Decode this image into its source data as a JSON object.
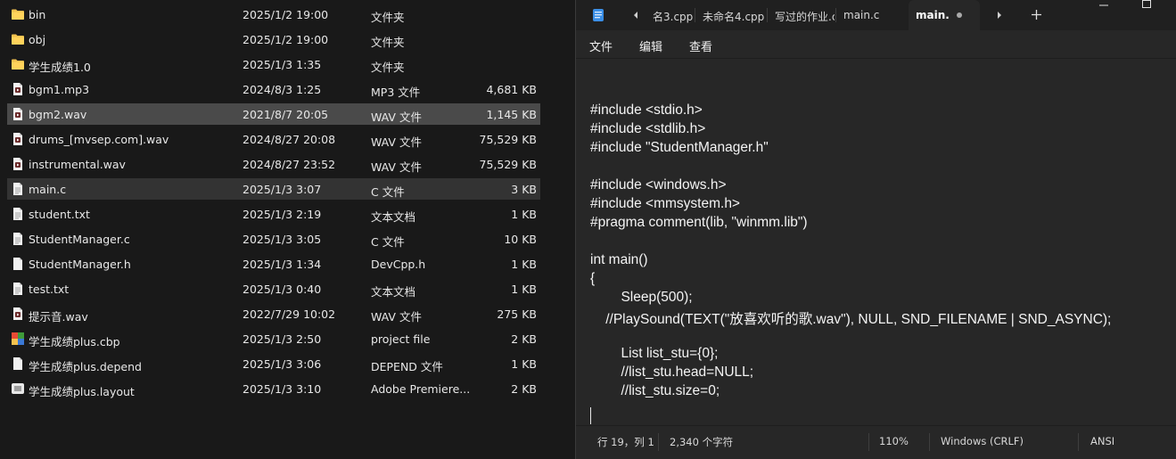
{
  "explorer": {
    "files": [
      {
        "name": "bin",
        "date": "2025/1/2 19:00",
        "type": "文件夹",
        "size": "",
        "icon": "folder-icon"
      },
      {
        "name": "obj",
        "date": "2025/1/2 19:00",
        "type": "文件夹",
        "size": "",
        "icon": "folder-icon"
      },
      {
        "name": "学生成绩1.0",
        "date": "2025/1/3 1:35",
        "type": "文件夹",
        "size": "",
        "icon": "folder-icon"
      },
      {
        "name": "bgm1.mp3",
        "date": "2024/8/3 1:25",
        "type": "MP3 文件",
        "size": "4,681 KB",
        "icon": "media-file-icon"
      },
      {
        "name": "bgm2.wav",
        "date": "2021/8/7 20:05",
        "type": "WAV 文件",
        "size": "1,145 KB",
        "icon": "media-file-icon"
      },
      {
        "name": "drums_[mvsep.com].wav",
        "date": "2024/8/27 20:08",
        "type": "WAV 文件",
        "size": "75,529 KB",
        "icon": "media-file-icon"
      },
      {
        "name": "instrumental.wav",
        "date": "2024/8/27 23:52",
        "type": "WAV 文件",
        "size": "75,529 KB",
        "icon": "media-file-icon"
      },
      {
        "name": "main.c",
        "date": "2025/1/3 3:07",
        "type": "C 文件",
        "size": "3 KB",
        "icon": "text-file-icon"
      },
      {
        "name": "student.txt",
        "date": "2025/1/3 2:19",
        "type": "文本文档",
        "size": "1 KB",
        "icon": "text-file-icon"
      },
      {
        "name": "StudentManager.c",
        "date": "2025/1/3 3:05",
        "type": "C 文件",
        "size": "10 KB",
        "icon": "text-file-icon"
      },
      {
        "name": "StudentManager.h",
        "date": "2025/1/3 1:34",
        "type": "DevCpp.h",
        "size": "1 KB",
        "icon": "blank-file-icon"
      },
      {
        "name": "test.txt",
        "date": "2025/1/3 0:40",
        "type": "文本文档",
        "size": "1 KB",
        "icon": "text-file-icon"
      },
      {
        "name": "提示音.wav",
        "date": "2022/7/29 10:02",
        "type": "WAV 文件",
        "size": "275 KB",
        "icon": "media-file-icon"
      },
      {
        "name": "学生成绩plus.cbp",
        "date": "2025/1/3 2:50",
        "type": "project file",
        "size": "2 KB",
        "icon": "codeblocks-project-icon"
      },
      {
        "name": "学生成绩plus.depend",
        "date": "2025/1/3 3:06",
        "type": "DEPEND 文件",
        "size": "1 KB",
        "icon": "blank-file-icon"
      },
      {
        "name": "学生成绩plus.layout",
        "date": "2025/1/3 3:10",
        "type": "Adobe Premiere...",
        "size": "2 KB",
        "icon": "premiere-file-icon"
      }
    ]
  },
  "notepad": {
    "tabs": [
      {
        "label": "名3.cpp",
        "active": false
      },
      {
        "label": "未命名4.cpp",
        "active": false
      },
      {
        "label": "写过的作业.c",
        "active": false
      },
      {
        "label": "main.c",
        "active": false
      },
      {
        "label": "main.c",
        "active": true
      }
    ],
    "menu": {
      "file": "文件",
      "edit": "编辑",
      "view": "查看"
    },
    "code_lines": [
      "",
      "#include <stdio.h>",
      "#include <stdlib.h>",
      "#include \"StudentManager.h\"",
      "",
      "#include <windows.h>",
      "#include <mmsystem.h>",
      "#pragma comment(lib, \"winmm.lib\")",
      "",
      "int main()",
      "{",
      "        Sleep(500);",
      "    //PlaySound(TEXT(\"放喜欢听的歌.wav\"), NULL, SND_FILENAME | SND_ASYNC);",
      "",
      "        List list_stu={0};",
      "        //list_stu.head=NULL;",
      "        //list_stu.size=0;",
      "",
      ""
    ],
    "status": {
      "position": "行 19，列 1",
      "chars": "2,340 个字符",
      "zoom": "110%",
      "line_ending": "Windows (CRLF)",
      "encoding": "ANSI"
    },
    "colors": {
      "accent_blue": "#3a8ee6",
      "folder_yellow": "#f2c14e"
    }
  }
}
